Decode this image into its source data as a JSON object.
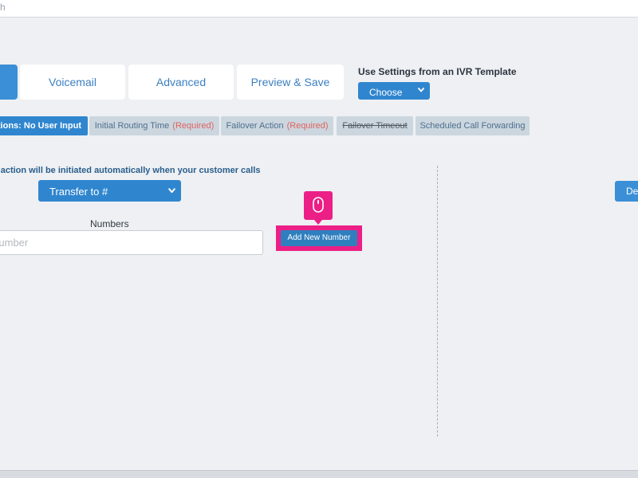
{
  "topbar": {
    "fragment": "h"
  },
  "main_tabs": [
    {
      "label": ""
    },
    {
      "label": "Voicemail"
    },
    {
      "label": "Advanced"
    },
    {
      "label": "Preview & Save"
    }
  ],
  "template": {
    "label": "Use Settings from an IVR Template",
    "select_value": "Choose"
  },
  "sub_tabs": [
    {
      "label": "ctions: No User Input",
      "required": ""
    },
    {
      "label": "Initial Routing Time",
      "required": "(Required)"
    },
    {
      "label": "Failover Action",
      "required": "(Required)"
    },
    {
      "label": "Failover Timeout",
      "required": ""
    },
    {
      "label": "Scheduled Call Forwarding",
      "required": ""
    }
  ],
  "content": {
    "instruction": "t action will be initiated automatically when your customer calls",
    "action_select_value": "Transfer to #",
    "numbers_label": "Numbers",
    "number_placeholder": "Number",
    "add_number_label": "Add New Number",
    "right_button_label": "De"
  },
  "icons": {
    "chevron": "chevron-down-icon",
    "cursor": "mouse-icon"
  },
  "colors": {
    "accent": "#2f86cf",
    "highlight": "#ec1f86",
    "required": "#e0625f"
  }
}
